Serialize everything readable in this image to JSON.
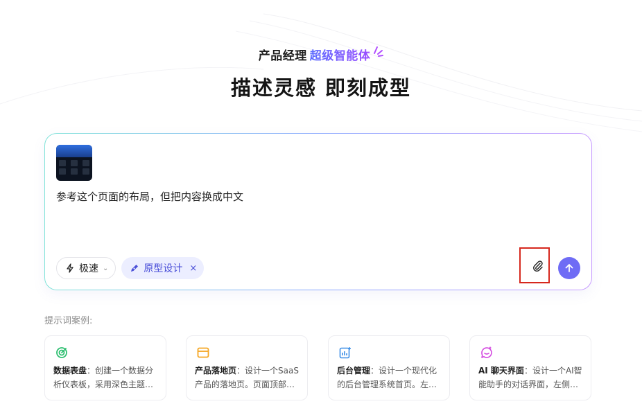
{
  "hero": {
    "subtitle_plain": "产品经理",
    "subtitle_accent": "超级智能体",
    "title": "描述灵感 即刻成型"
  },
  "composer": {
    "prompt_text": "参考这个页面的布局，但把内容换成中文",
    "mode_label": "极速",
    "tag_label": "原型设计"
  },
  "examples": {
    "label": "提示词案例:",
    "cards": [
      {
        "title": "数据表盘",
        "desc": "：创建一个数据分析仪表板，采用深色主题…"
      },
      {
        "title": "产品落地页",
        "desc": "：设计一个SaaS产品的落地页。页面顶部…"
      },
      {
        "title": "后台管理",
        "desc": "：设计一个现代化的后台管理系统首页。左…"
      },
      {
        "title": "AI 聊天界面",
        "desc": "：设计一个AI智能助手的对话界面，左侧…"
      }
    ]
  },
  "colors": {
    "accent": "#6f6cf5",
    "highlight_box": "#d6271d",
    "tag_background": "#eceeff"
  }
}
